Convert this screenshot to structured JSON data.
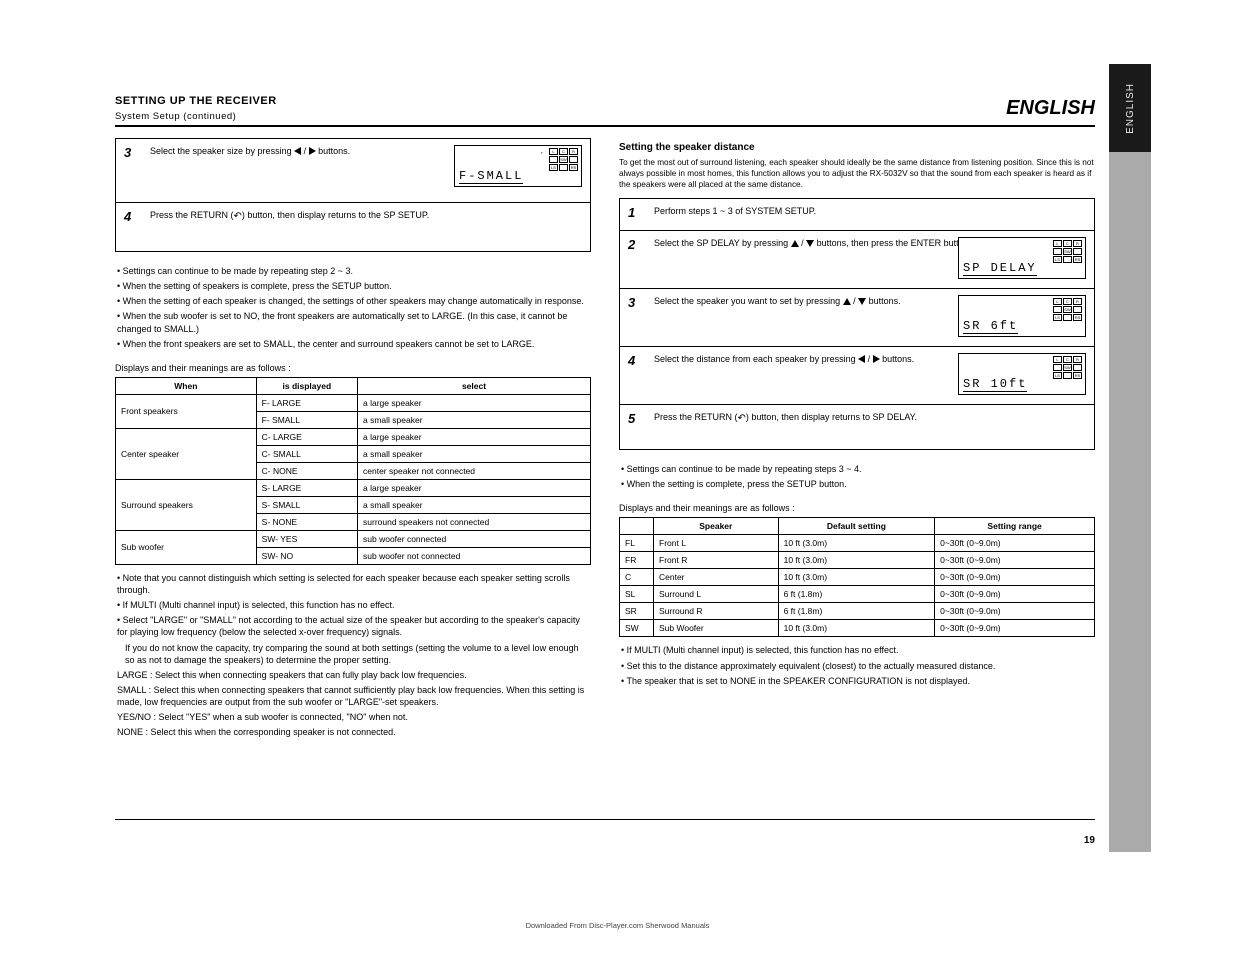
{
  "header": {
    "left_title": "SETTING UP THE RECEIVER",
    "left_sub": "System Setup (continued)",
    "right": "ENGLISH"
  },
  "sidebar": {
    "label": "ENGLISH"
  },
  "left": {
    "steps": [
      {
        "num": "3",
        "text_before": "Select the speaker size by pressing ",
        "text_after": " buttons."
      },
      {
        "num": "4",
        "text_before_icon": "Press the RETURN (",
        "text_after_icon": ") button, then display returns to the SP SETUP."
      }
    ],
    "lcd": {
      "display": "F-SMALL",
      "icons": [
        "L",
        "C",
        "R",
        "SW",
        "LS",
        "RS"
      ]
    },
    "notes": [
      "Settings can continue to be made by repeating step 2 ~ 3.",
      "When the setting of speakers is complete, press the SETUP button.",
      "When the setting of each speaker is changed, the settings of other speakers may change automatically in response.",
      "When the sub woofer is set to NO, the front speakers are automatically set to LARGE. (In this case, it cannot be changed to SMALL.)",
      "When the front speakers are set to SMALL, the center and surround speakers cannot be set to LARGE."
    ],
    "table": {
      "header": [
        "When",
        "is displayed",
        "select"
      ],
      "rows": [
        {
          "label": "Front speakers",
          "disp_rows": [
            [
              "F- LARGE",
              "a large speaker"
            ],
            [
              "F- SMALL",
              "a small speaker"
            ]
          ]
        },
        {
          "label": "Center speaker",
          "disp_rows": [
            [
              "C- LARGE",
              "a large speaker"
            ],
            [
              "C- SMALL",
              "a small speaker"
            ],
            [
              "C- NONE",
              "center speaker not connected"
            ]
          ]
        },
        {
          "label": "Surround speakers",
          "disp_rows": [
            [
              "S- LARGE",
              "a large speaker"
            ],
            [
              "S- SMALL",
              "a small speaker"
            ],
            [
              "S- NONE",
              "surround speakers not connected"
            ]
          ]
        },
        {
          "label": "Sub woofer",
          "disp_rows": [
            [
              "SW- YES",
              "sub woofer connected"
            ],
            [
              "SW- NO",
              "sub woofer not connected"
            ]
          ]
        }
      ]
    },
    "tablecaption": "Displays and their meanings are as follows :",
    "footnotes": [
      "Note that you cannot distinguish which setting is selected for each speaker because each speaker setting scrolls through.",
      "If MULTI (Multi channel input) is selected, this function has no effect.",
      "Select \"LARGE\" or \"SMALL\" not according to the actual size of the speaker but according to the speaker's capacity for playing low frequency (below the selected x-over frequency) signals.",
      "If you do not know the capacity, try comparing the sound at both settings (setting the volume to a level low enough so as not to damage the speakers) to determine the proper setting.",
      "LARGE   : Select this when connecting speakers that can fully play back low frequencies.",
      "SMALL   : Select this when connecting speakers that cannot sufficiently play back low frequencies. When this setting is made, low frequencies are output from the sub woofer or \"LARGE\"-set speakers.",
      "YES/NO : Select \"YES\" when a sub woofer is connected, \"NO\" when not.",
      "NONE    : Select this when the corresponding speaker is not connected."
    ]
  },
  "right": {
    "section_title": "Setting the speaker distance",
    "section_para": "To get the most out of surround listening, each speaker should ideally be the same distance from listening position. Since this is not always possible in most homes, this function allows you to adjust the RX-5032V so that the sound from each speaker is heard as if the speakers were all placed at the same distance.",
    "steps": [
      {
        "num": "1",
        "text": "Perform steps 1 ~ 3 of SYSTEM SETUP."
      },
      {
        "num": "2",
        "text_before": "Select the SP DELAY by pressing ",
        "text_after": " buttons, then press the ENTER button."
      },
      {
        "num": "3",
        "text_before": "Select the speaker you want to set by pressing ",
        "text_after": " buttons."
      },
      {
        "num": "4",
        "text_before": "Select the distance from each speaker by pressing ",
        "text_after": " buttons."
      },
      {
        "num": "5",
        "text_before_icon": "Press the RETURN (",
        "text_after_icon": ") button, then display returns to SP DELAY."
      }
    ],
    "lcds": [
      {
        "display": "SP DELAY"
      },
      {
        "display": "SR   6ft"
      },
      {
        "display": "SR  10ft"
      }
    ],
    "notes": [
      "Settings can continue to be made by repeating steps 3 ~ 4.",
      "When the setting is complete, press the SETUP button."
    ],
    "tablecaption": "Displays and their meanings are as follows :",
    "table": {
      "header": [
        "",
        "Speaker",
        "Default setting",
        "Setting range"
      ],
      "rows": [
        [
          "FL",
          "Front L",
          "10 ft (3.0m)",
          "0~30ft (0~9.0m)"
        ],
        [
          "FR",
          "Front R",
          "10 ft (3.0m)",
          "0~30ft (0~9.0m)"
        ],
        [
          "C",
          "Center",
          "10 ft (3.0m)",
          "0~30ft (0~9.0m)"
        ],
        [
          "SL",
          "Surround L",
          "6 ft (1.8m)",
          "0~30ft (0~9.0m)"
        ],
        [
          "SR",
          "Surround R",
          "6 ft (1.8m)",
          "0~30ft (0~9.0m)"
        ],
        [
          "SW",
          "Sub Woofer",
          "10 ft (3.0m)",
          "0~30ft (0~9.0m)"
        ]
      ]
    },
    "footnotes": [
      "If MULTI (Multi channel input) is selected, this function has no effect.",
      "Set this to the distance approximately equivalent (closest) to the actually measured distance.",
      "The speaker that is set to NONE in the SPEAKER CONFIGURATION is not displayed."
    ]
  },
  "page_number": "19",
  "foot_tag": "Downloaded From Disc-Player.com Sherwood Manuals"
}
